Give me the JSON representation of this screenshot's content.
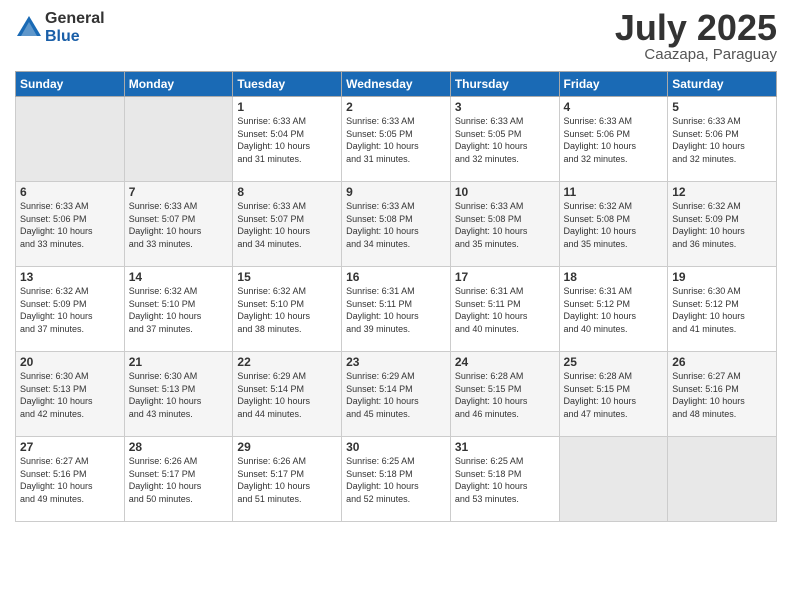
{
  "logo": {
    "general": "General",
    "blue": "Blue"
  },
  "title": "July 2025",
  "location": "Caazapa, Paraguay",
  "days_of_week": [
    "Sunday",
    "Monday",
    "Tuesday",
    "Wednesday",
    "Thursday",
    "Friday",
    "Saturday"
  ],
  "weeks": [
    [
      {
        "day": "",
        "info": ""
      },
      {
        "day": "",
        "info": ""
      },
      {
        "day": "1",
        "info": "Sunrise: 6:33 AM\nSunset: 5:04 PM\nDaylight: 10 hours\nand 31 minutes."
      },
      {
        "day": "2",
        "info": "Sunrise: 6:33 AM\nSunset: 5:05 PM\nDaylight: 10 hours\nand 31 minutes."
      },
      {
        "day": "3",
        "info": "Sunrise: 6:33 AM\nSunset: 5:05 PM\nDaylight: 10 hours\nand 32 minutes."
      },
      {
        "day": "4",
        "info": "Sunrise: 6:33 AM\nSunset: 5:06 PM\nDaylight: 10 hours\nand 32 minutes."
      },
      {
        "day": "5",
        "info": "Sunrise: 6:33 AM\nSunset: 5:06 PM\nDaylight: 10 hours\nand 32 minutes."
      }
    ],
    [
      {
        "day": "6",
        "info": "Sunrise: 6:33 AM\nSunset: 5:06 PM\nDaylight: 10 hours\nand 33 minutes."
      },
      {
        "day": "7",
        "info": "Sunrise: 6:33 AM\nSunset: 5:07 PM\nDaylight: 10 hours\nand 33 minutes."
      },
      {
        "day": "8",
        "info": "Sunrise: 6:33 AM\nSunset: 5:07 PM\nDaylight: 10 hours\nand 34 minutes."
      },
      {
        "day": "9",
        "info": "Sunrise: 6:33 AM\nSunset: 5:08 PM\nDaylight: 10 hours\nand 34 minutes."
      },
      {
        "day": "10",
        "info": "Sunrise: 6:33 AM\nSunset: 5:08 PM\nDaylight: 10 hours\nand 35 minutes."
      },
      {
        "day": "11",
        "info": "Sunrise: 6:32 AM\nSunset: 5:08 PM\nDaylight: 10 hours\nand 35 minutes."
      },
      {
        "day": "12",
        "info": "Sunrise: 6:32 AM\nSunset: 5:09 PM\nDaylight: 10 hours\nand 36 minutes."
      }
    ],
    [
      {
        "day": "13",
        "info": "Sunrise: 6:32 AM\nSunset: 5:09 PM\nDaylight: 10 hours\nand 37 minutes."
      },
      {
        "day": "14",
        "info": "Sunrise: 6:32 AM\nSunset: 5:10 PM\nDaylight: 10 hours\nand 37 minutes."
      },
      {
        "day": "15",
        "info": "Sunrise: 6:32 AM\nSunset: 5:10 PM\nDaylight: 10 hours\nand 38 minutes."
      },
      {
        "day": "16",
        "info": "Sunrise: 6:31 AM\nSunset: 5:11 PM\nDaylight: 10 hours\nand 39 minutes."
      },
      {
        "day": "17",
        "info": "Sunrise: 6:31 AM\nSunset: 5:11 PM\nDaylight: 10 hours\nand 40 minutes."
      },
      {
        "day": "18",
        "info": "Sunrise: 6:31 AM\nSunset: 5:12 PM\nDaylight: 10 hours\nand 40 minutes."
      },
      {
        "day": "19",
        "info": "Sunrise: 6:30 AM\nSunset: 5:12 PM\nDaylight: 10 hours\nand 41 minutes."
      }
    ],
    [
      {
        "day": "20",
        "info": "Sunrise: 6:30 AM\nSunset: 5:13 PM\nDaylight: 10 hours\nand 42 minutes."
      },
      {
        "day": "21",
        "info": "Sunrise: 6:30 AM\nSunset: 5:13 PM\nDaylight: 10 hours\nand 43 minutes."
      },
      {
        "day": "22",
        "info": "Sunrise: 6:29 AM\nSunset: 5:14 PM\nDaylight: 10 hours\nand 44 minutes."
      },
      {
        "day": "23",
        "info": "Sunrise: 6:29 AM\nSunset: 5:14 PM\nDaylight: 10 hours\nand 45 minutes."
      },
      {
        "day": "24",
        "info": "Sunrise: 6:28 AM\nSunset: 5:15 PM\nDaylight: 10 hours\nand 46 minutes."
      },
      {
        "day": "25",
        "info": "Sunrise: 6:28 AM\nSunset: 5:15 PM\nDaylight: 10 hours\nand 47 minutes."
      },
      {
        "day": "26",
        "info": "Sunrise: 6:27 AM\nSunset: 5:16 PM\nDaylight: 10 hours\nand 48 minutes."
      }
    ],
    [
      {
        "day": "27",
        "info": "Sunrise: 6:27 AM\nSunset: 5:16 PM\nDaylight: 10 hours\nand 49 minutes."
      },
      {
        "day": "28",
        "info": "Sunrise: 6:26 AM\nSunset: 5:17 PM\nDaylight: 10 hours\nand 50 minutes."
      },
      {
        "day": "29",
        "info": "Sunrise: 6:26 AM\nSunset: 5:17 PM\nDaylight: 10 hours\nand 51 minutes."
      },
      {
        "day": "30",
        "info": "Sunrise: 6:25 AM\nSunset: 5:18 PM\nDaylight: 10 hours\nand 52 minutes."
      },
      {
        "day": "31",
        "info": "Sunrise: 6:25 AM\nSunset: 5:18 PM\nDaylight: 10 hours\nand 53 minutes."
      },
      {
        "day": "",
        "info": ""
      },
      {
        "day": "",
        "info": ""
      }
    ]
  ]
}
